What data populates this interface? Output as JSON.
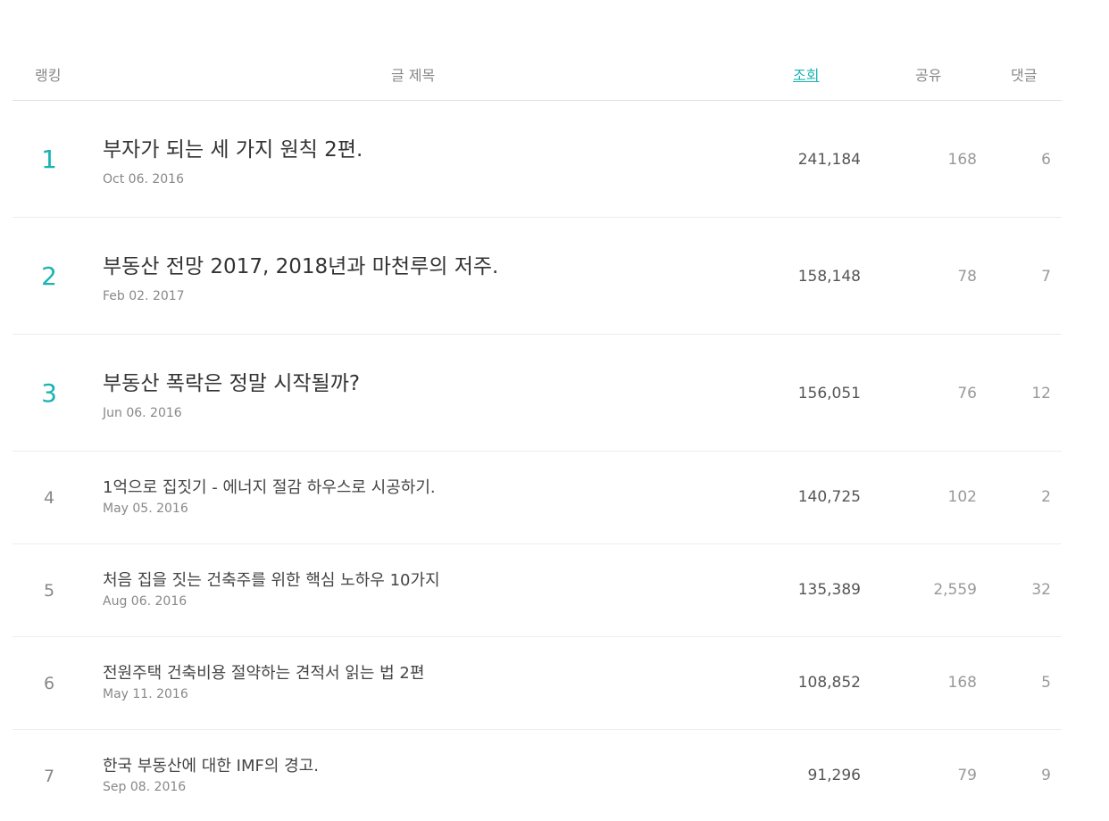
{
  "header": {
    "rank": "랭킹",
    "title": "글 제목",
    "views": "조회",
    "share": "공유",
    "comments": "댓글"
  },
  "accent_color": "#1ab3b3",
  "rows": [
    {
      "rank": "1",
      "title": "부자가 되는 세 가지 원칙 2편.",
      "date": "Oct 06. 2016",
      "views": "241,184",
      "share": "168",
      "comments": "6"
    },
    {
      "rank": "2",
      "title": "부동산 전망 2017, 2018년과 마천루의 저주.",
      "date": "Feb 02. 2017",
      "views": "158,148",
      "share": "78",
      "comments": "7"
    },
    {
      "rank": "3",
      "title": "부동산 폭락은 정말 시작될까?",
      "date": "Jun 06. 2016",
      "views": "156,051",
      "share": "76",
      "comments": "12"
    },
    {
      "rank": "4",
      "title": "1억으로 집짓기 - 에너지 절감 하우스로 시공하기.",
      "date": "May 05. 2016",
      "views": "140,725",
      "share": "102",
      "comments": "2"
    },
    {
      "rank": "5",
      "title": "처음 집을 짓는 건축주를 위한 핵심 노하우 10가지",
      "date": "Aug 06. 2016",
      "views": "135,389",
      "share": "2,559",
      "comments": "32"
    },
    {
      "rank": "6",
      "title": "전원주택 건축비용 절약하는 견적서 읽는 법 2편",
      "date": "May 11. 2016",
      "views": "108,852",
      "share": "168",
      "comments": "5"
    },
    {
      "rank": "7",
      "title": "한국 부동산에 대한 IMF의 경고.",
      "date": "Sep 08. 2016",
      "views": "91,296",
      "share": "79",
      "comments": "9"
    }
  ]
}
